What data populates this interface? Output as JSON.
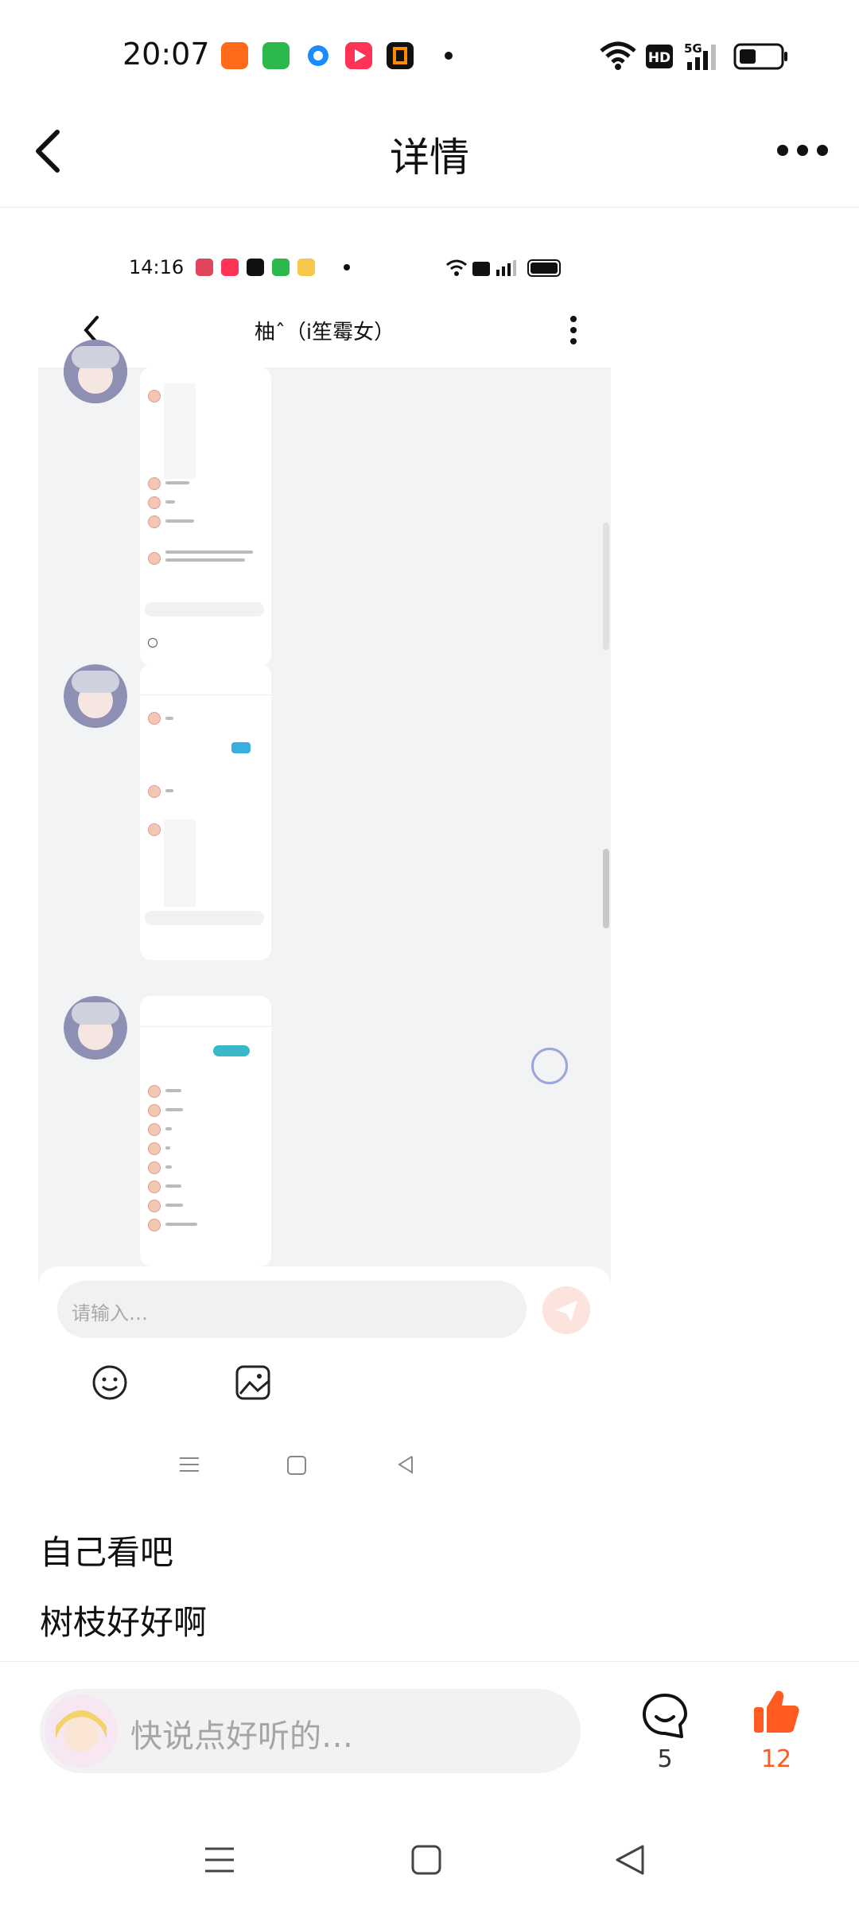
{
  "status_bar": {
    "time": "20:07",
    "app_icons": [
      {
        "name": "kuaishou-icon",
        "color": "#ff6a1a"
      },
      {
        "name": "shop-icon",
        "color": "#2db84d"
      },
      {
        "name": "browser-icon",
        "color": "#1a8cff"
      },
      {
        "name": "video-icon",
        "color": "#ff3355"
      },
      {
        "name": "reader-icon",
        "color": "#111111"
      }
    ]
  },
  "header": {
    "title": "详情"
  },
  "embedded_screenshot": {
    "time": "14:16",
    "chat_title": "柚ˆ（i笙霉女）",
    "input_placeholder": "请输入…"
  },
  "post": {
    "line1": "自己看吧",
    "line2": "树枝好好啊"
  },
  "comment_bar": {
    "placeholder": "快说点好听的…",
    "comment_count": "5",
    "like_count": "12",
    "accent_color": "#ff5a1f"
  }
}
